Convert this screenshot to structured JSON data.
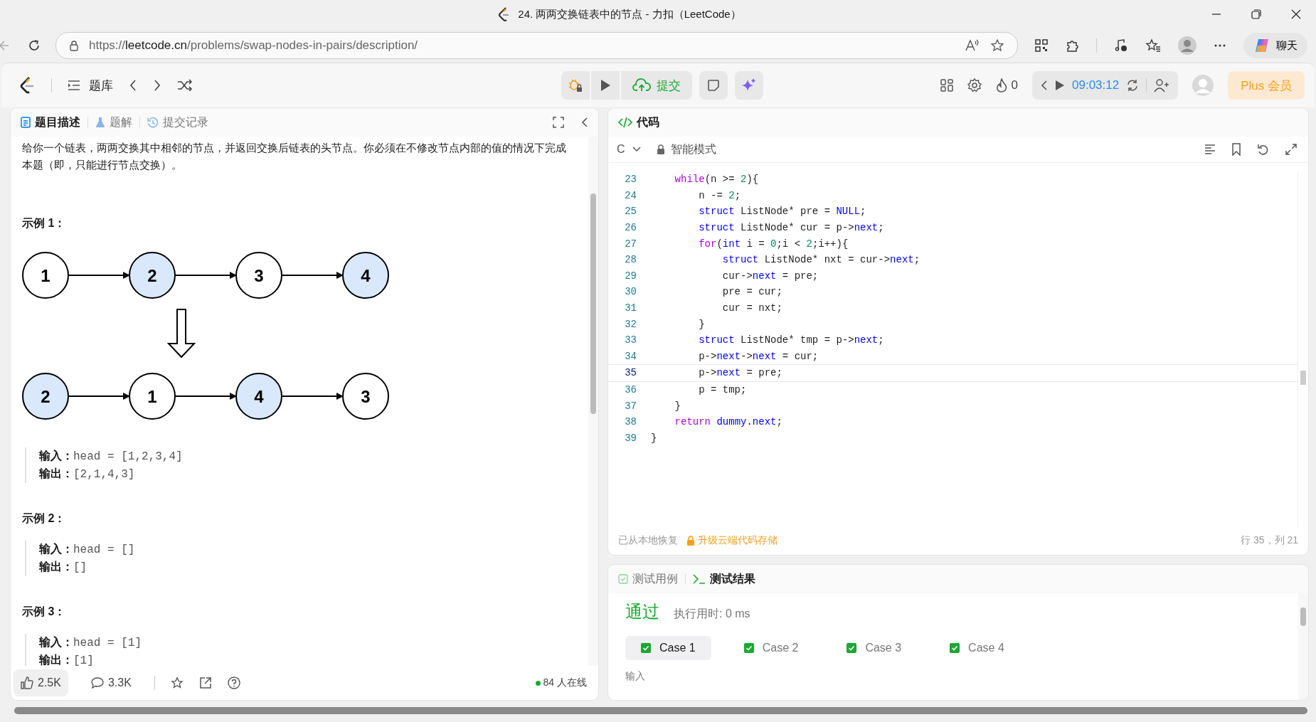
{
  "window": {
    "title": "24. 两两交换链表中的节点 - 力扣（LeetCode）"
  },
  "browser": {
    "url_host": "leetcode.cn",
    "url_scheme": "https://",
    "url_path": "/problems/swap-nodes-in-pairs/description/",
    "chat_label": "聊天"
  },
  "toolbar": {
    "problem_list": "题库",
    "submit": "提交",
    "streak": "0",
    "timer": "09:03:12",
    "plus": "Plus 会员"
  },
  "left_panel": {
    "tabs": [
      {
        "label": "题目描述",
        "selected": true
      },
      {
        "label": "题解",
        "selected": false
      },
      {
        "label": "提交记录",
        "selected": false
      }
    ],
    "description": "给你一个链表，两两交换其中相邻的节点，并返回交换后链表的头节点。你必须在不修改节点内部的值的情况下完成本题（即，只能进行节点交换）。",
    "examples": [
      {
        "title": "示例 1：",
        "diagram": {
          "before": [
            {
              "label": "1",
              "highlighted": false
            },
            {
              "label": "2",
              "highlighted": true
            },
            {
              "label": "3",
              "highlighted": false
            },
            {
              "label": "4",
              "highlighted": true
            }
          ],
          "after": [
            {
              "label": "2",
              "highlighted": true
            },
            {
              "label": "1",
              "highlighted": false
            },
            {
              "label": "4",
              "highlighted": true
            },
            {
              "label": "3",
              "highlighted": false
            }
          ]
        },
        "input_label": "输入：",
        "input": "head = [1,2,3,4]",
        "output_label": "输出：",
        "output": "[2,1,4,3]"
      },
      {
        "title": "示例 2：",
        "input_label": "输入：",
        "input": "head = []",
        "output_label": "输出：",
        "output": "[]"
      },
      {
        "title": "示例 3：",
        "input_label": "输入：",
        "input": "head = [1]",
        "output_label": "输出：",
        "output": "[1]"
      }
    ],
    "footer": {
      "likes": "2.5K",
      "comments": "3.3K",
      "online": "84 人在线"
    }
  },
  "editor": {
    "title": "代码",
    "language": "C",
    "mode": "智能模式",
    "lines": [
      {
        "n": "23",
        "current": false,
        "tokens": [
          {
            "t": "    while",
            "kind": "kw"
          },
          {
            "t": "(n >= ",
            "kind": "plain"
          },
          {
            "t": "2",
            "kind": "num"
          },
          {
            "t": "){",
            "kind": "plain"
          }
        ]
      },
      {
        "n": "24",
        "current": false,
        "tokens": [
          {
            "t": "        n -= ",
            "kind": "plain"
          },
          {
            "t": "2",
            "kind": "num"
          },
          {
            "t": ";",
            "kind": "plain"
          }
        ]
      },
      {
        "n": "25",
        "current": false,
        "tokens": [
          {
            "t": "        struct",
            "kind": "type"
          },
          {
            "t": " ListNode* pre = ",
            "kind": "plain"
          },
          {
            "t": "NULL",
            "kind": "type"
          },
          {
            "t": ";",
            "kind": "plain"
          }
        ]
      },
      {
        "n": "26",
        "current": false,
        "tokens": [
          {
            "t": "        struct",
            "kind": "type"
          },
          {
            "t": " ListNode* cur = p->",
            "kind": "plain"
          },
          {
            "t": "next",
            "kind": "type"
          },
          {
            "t": ";",
            "kind": "plain"
          }
        ]
      },
      {
        "n": "27",
        "current": false,
        "tokens": [
          {
            "t": "        for",
            "kind": "kw"
          },
          {
            "t": "(",
            "kind": "plain"
          },
          {
            "t": "int",
            "kind": "type"
          },
          {
            "t": " i = ",
            "kind": "plain"
          },
          {
            "t": "0",
            "kind": "num"
          },
          {
            "t": ";i < ",
            "kind": "plain"
          },
          {
            "t": "2",
            "kind": "num"
          },
          {
            "t": ";i++){",
            "kind": "plain"
          }
        ]
      },
      {
        "n": "28",
        "current": false,
        "tokens": [
          {
            "t": "            struct",
            "kind": "type"
          },
          {
            "t": " ListNode* nxt = cur->",
            "kind": "plain"
          },
          {
            "t": "next",
            "kind": "type"
          },
          {
            "t": ";",
            "kind": "plain"
          }
        ]
      },
      {
        "n": "29",
        "current": false,
        "tokens": [
          {
            "t": "            cur->",
            "kind": "plain"
          },
          {
            "t": "next",
            "kind": "type"
          },
          {
            "t": " = pre;",
            "kind": "plain"
          }
        ]
      },
      {
        "n": "30",
        "current": false,
        "tokens": [
          {
            "t": "            pre = cur;",
            "kind": "plain"
          }
        ]
      },
      {
        "n": "31",
        "current": false,
        "tokens": [
          {
            "t": "            cur = nxt;",
            "kind": "plain"
          }
        ]
      },
      {
        "n": "32",
        "current": false,
        "tokens": [
          {
            "t": "        }",
            "kind": "plain"
          }
        ]
      },
      {
        "n": "33",
        "current": false,
        "tokens": [
          {
            "t": "        struct",
            "kind": "type"
          },
          {
            "t": " ListNode* tmp = p->",
            "kind": "plain"
          },
          {
            "t": "next",
            "kind": "type"
          },
          {
            "t": ";",
            "kind": "plain"
          }
        ]
      },
      {
        "n": "34",
        "current": false,
        "tokens": [
          {
            "t": "        p->",
            "kind": "plain"
          },
          {
            "t": "next",
            "kind": "type"
          },
          {
            "t": "->",
            "kind": "plain"
          },
          {
            "t": "next",
            "kind": "type"
          },
          {
            "t": " = cur;",
            "kind": "plain"
          }
        ]
      },
      {
        "n": "35",
        "current": true,
        "tokens": [
          {
            "t": "        p->",
            "kind": "plain"
          },
          {
            "t": "next",
            "kind": "type"
          },
          {
            "t": " = pre;",
            "kind": "plain"
          }
        ]
      },
      {
        "n": "36",
        "current": false,
        "tokens": [
          {
            "t": "        p = tmp;",
            "kind": "plain"
          }
        ]
      },
      {
        "n": "37",
        "current": false,
        "tokens": [
          {
            "t": "    }",
            "kind": "plain"
          }
        ]
      },
      {
        "n": "38",
        "current": false,
        "tokens": [
          {
            "t": "    return ",
            "kind": "kw"
          },
          {
            "t": "dummy.next",
            "kind": "type"
          },
          {
            "t": ";",
            "kind": "plain"
          }
        ]
      },
      {
        "n": "39",
        "current": false,
        "tokens": [
          {
            "t": "}",
            "kind": "plain"
          }
        ]
      }
    ],
    "restored": "已从本地恢复",
    "upgrade": "升级云端代码存储",
    "cursor": "行 35，列 21"
  },
  "results": {
    "tabs": [
      {
        "label": "测试用例",
        "selected": false
      },
      {
        "label": "测试结果",
        "selected": true
      }
    ],
    "verdict": "通过",
    "runtime": "执行用时: 0 ms",
    "cases": [
      {
        "label": "Case 1",
        "selected": true,
        "passed": true
      },
      {
        "label": "Case 2",
        "selected": false,
        "passed": true
      },
      {
        "label": "Case 3",
        "selected": false,
        "passed": true
      },
      {
        "label": "Case 4",
        "selected": false,
        "passed": true
      }
    ],
    "input_label": "输入"
  }
}
